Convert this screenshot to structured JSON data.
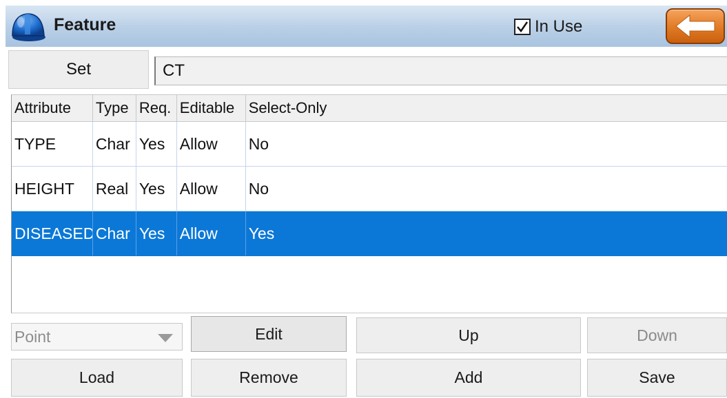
{
  "header": {
    "title": "Feature",
    "title_icon": "hardhat-icon",
    "in_use_label": "In Use",
    "in_use_checked": true,
    "back_icon": "back-arrow-icon"
  },
  "set": {
    "button_label": "Set",
    "value": "CT"
  },
  "table": {
    "columns": [
      "Attribute",
      "Type",
      "Req.",
      "Editable",
      "Select-Only"
    ],
    "rows": [
      {
        "attribute": "TYPE",
        "type": "Char",
        "req": "Yes",
        "editable": "Allow",
        "select_only": "No",
        "selected": false
      },
      {
        "attribute": "HEIGHT",
        "type": "Real",
        "req": "Yes",
        "editable": "Allow",
        "select_only": "No",
        "selected": false
      },
      {
        "attribute": "DISEASED",
        "type": "Char",
        "req": "Yes",
        "editable": "Allow",
        "select_only": "Yes",
        "selected": true
      }
    ]
  },
  "controls": {
    "geometry_select": "Point",
    "edit": "Edit",
    "up": "Up",
    "down": "Down",
    "load": "Load",
    "remove": "Remove",
    "add": "Add",
    "save": "Save"
  },
  "colors": {
    "header_gradient": "#b9cfe6",
    "selection": "#0b78d7",
    "back_button": "#e07a24"
  }
}
